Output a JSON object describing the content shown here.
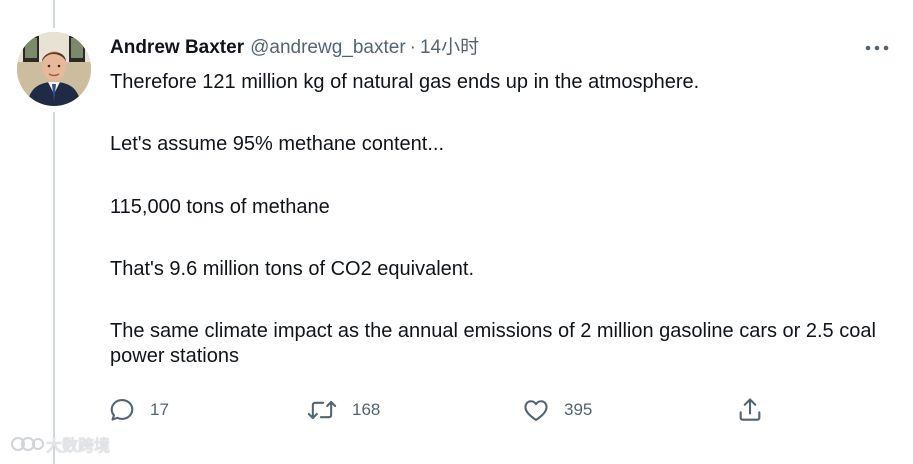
{
  "tweet": {
    "display_name": "Andrew Baxter",
    "handle": "@andrewg_baxter",
    "separator": "·",
    "timestamp": "14小时",
    "paragraphs": [
      "Therefore 121 million kg of natural gas ends up in the atmosphere.",
      "Let's assume 95% methane content...",
      "115,000 tons of methane",
      "That's 9.6 million tons of CO2 equivalent.",
      "The same climate impact as the annual emissions of 2 million gasoline cars or 2.5 coal power stations"
    ]
  },
  "actions": {
    "reply_count": "17",
    "retweet_count": "168",
    "like_count": "395"
  },
  "icons": {
    "reply": "reply-icon",
    "retweet": "retweet-icon",
    "like": "heart-icon",
    "share": "share-icon",
    "more": "more-options-icon"
  },
  "watermark": {
    "text": "大数跨境"
  },
  "colors": {
    "text_primary": "#0f1419",
    "text_secondary": "#536471",
    "thread_line": "#cfd9de"
  }
}
